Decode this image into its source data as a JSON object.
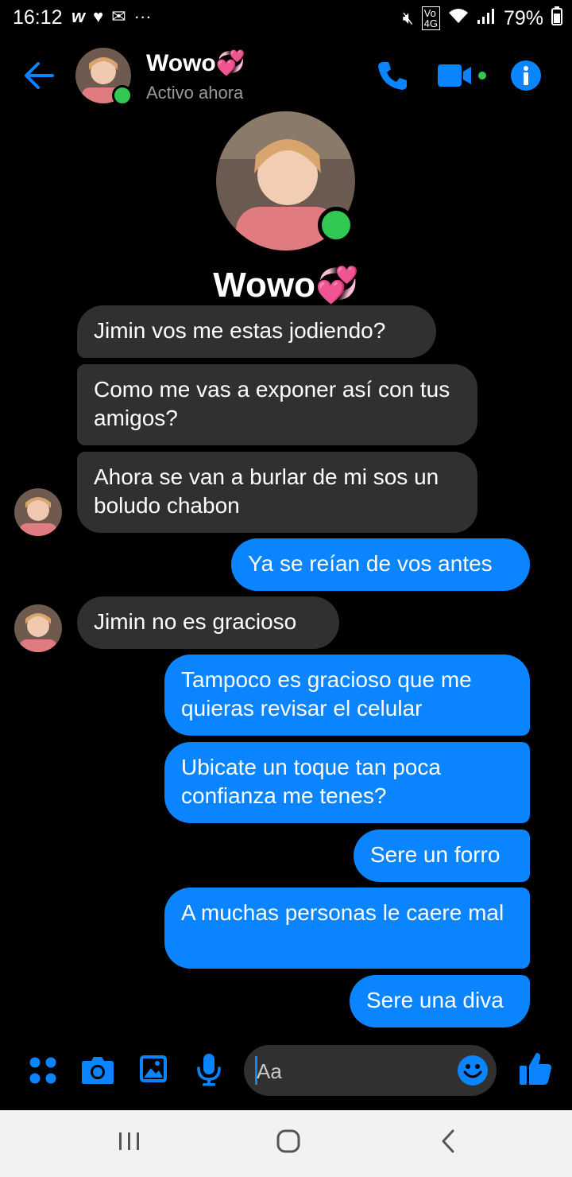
{
  "status_bar": {
    "time": "16:12",
    "left_icons": [
      "w-app-icon",
      "heart-icon",
      "mail-icon",
      "more-dots-icon"
    ],
    "battery": "79%",
    "right_icons": [
      "mute-icon",
      "volte-icon",
      "wifi-icon",
      "signal-icon",
      "battery-icon"
    ]
  },
  "header": {
    "name": "Wowo💞",
    "status": "Activo ahora",
    "accent": "#0a84ff"
  },
  "profile": {
    "name": "Wowo💞"
  },
  "messages": [
    {
      "from": "them",
      "text": "Jimin vos me estas jodiendo?"
    },
    {
      "from": "them",
      "text": "Como me vas a exponer así con tus amigos?"
    },
    {
      "from": "them",
      "text": "Ahora se van a burlar de mi sos un boludo chabon"
    },
    {
      "from": "me",
      "text": "Ya se reían de vos antes"
    },
    {
      "from": "them",
      "text": "Jimin no es gracioso"
    },
    {
      "from": "me",
      "text": "Tampoco es gracioso que me quieras revisar el celular"
    },
    {
      "from": "me",
      "text": "Ubicate un toque tan poca confianza me tenes?"
    },
    {
      "from": "me",
      "text": "Sere un forro"
    },
    {
      "from": "me",
      "text": "A muchas personas le caere mal"
    },
    {
      "from": "me",
      "text": "Sere una diva"
    }
  ],
  "composer": {
    "placeholder": "Aa"
  }
}
